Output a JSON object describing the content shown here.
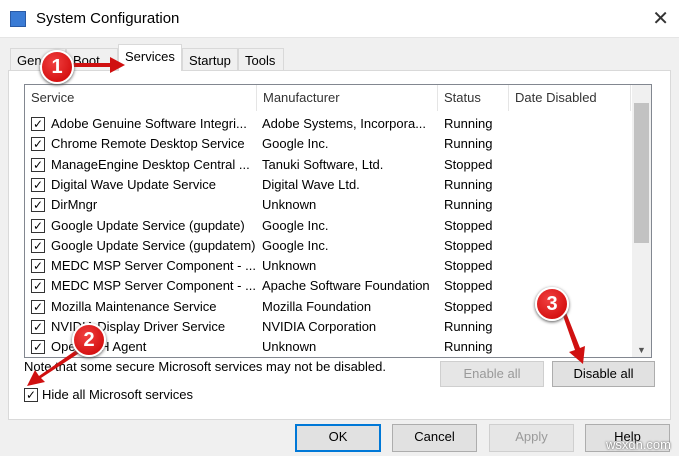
{
  "window": {
    "title": "System Configuration",
    "close": "✕"
  },
  "tabs": [
    "General",
    "Boot",
    "Services",
    "Startup",
    "Tools"
  ],
  "columns": [
    "Service",
    "Manufacturer",
    "Status",
    "Date Disabled"
  ],
  "services": [
    {
      "name": "Adobe Genuine Software Integri...",
      "manufacturer": "Adobe Systems, Incorpora...",
      "status": "Running",
      "checked": true
    },
    {
      "name": "Chrome Remote Desktop Service",
      "manufacturer": "Google Inc.",
      "status": "Running",
      "checked": true
    },
    {
      "name": "ManageEngine Desktop Central ...",
      "manufacturer": "Tanuki Software, Ltd.",
      "status": "Stopped",
      "checked": true
    },
    {
      "name": "Digital Wave Update Service",
      "manufacturer": "Digital Wave Ltd.",
      "status": "Running",
      "checked": true
    },
    {
      "name": "DirMngr",
      "manufacturer": "Unknown",
      "status": "Running",
      "checked": true
    },
    {
      "name": "Google Update Service (gupdate)",
      "manufacturer": "Google Inc.",
      "status": "Stopped",
      "checked": true
    },
    {
      "name": "Google Update Service (gupdatem)",
      "manufacturer": "Google Inc.",
      "status": "Stopped",
      "checked": true
    },
    {
      "name": "MEDC MSP Server Component - ...",
      "manufacturer": "Unknown",
      "status": "Stopped",
      "checked": true
    },
    {
      "name": "MEDC MSP Server Component - ...",
      "manufacturer": "Apache Software Foundation",
      "status": "Stopped",
      "checked": true
    },
    {
      "name": "Mozilla Maintenance Service",
      "manufacturer": "Mozilla Foundation",
      "status": "Stopped",
      "checked": true
    },
    {
      "name": "NVIDIA Display Driver Service",
      "manufacturer": "NVIDIA Corporation",
      "status": "Running",
      "checked": true
    },
    {
      "name": "OpenSSH Agent",
      "manufacturer": "Unknown",
      "status": "Running",
      "checked": true
    }
  ],
  "note": "Note that some secure Microsoft services may not be disabled.",
  "enable_all": "Enable all",
  "disable_all": "Disable all",
  "hide_ms": {
    "label": "Hide all Microsoft services",
    "checked": true
  },
  "buttons": {
    "ok": "OK",
    "cancel": "Cancel",
    "apply": "Apply",
    "help": "Help"
  },
  "badges": [
    "1",
    "2",
    "3"
  ],
  "watermark": "wsxdn.com",
  "colors": {
    "badge": "#d01010",
    "focus": "#0078d7"
  }
}
